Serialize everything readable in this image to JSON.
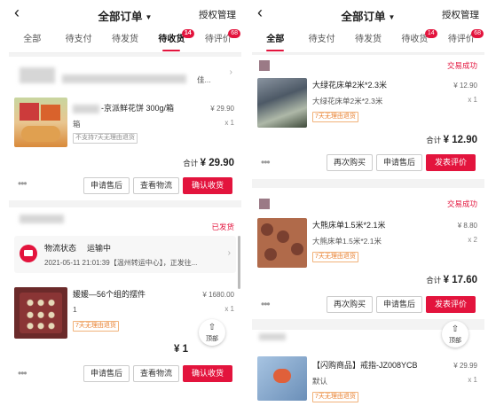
{
  "common": {
    "back_icon": "‹",
    "title": "全部订单",
    "caret": "▼",
    "auth": "授权管理",
    "more": "•••",
    "top_arrow": "⇧",
    "top_label": "顶部",
    "chevron": "›"
  },
  "left": {
    "tabs": [
      {
        "label": "全部",
        "badge": ""
      },
      {
        "label": "待支付",
        "badge": ""
      },
      {
        "label": "待发货",
        "badge": ""
      },
      {
        "label": "待收货",
        "badge": "14"
      },
      {
        "label": "待评价",
        "badge": "68"
      }
    ],
    "order1": {
      "shop_suffix": "佳...",
      "title": "-京派鲜花饼  300g/箱",
      "spec": "箱",
      "price": "¥ 29.90",
      "qty": "x 1",
      "tag": "不支持7天无理由退货",
      "total_label": "合计",
      "total_value": "¥ 29.90",
      "buttons": [
        "申请售后",
        "查看物流",
        "确认收货"
      ]
    },
    "order2": {
      "status": "已发货",
      "logistics_label": "物流状态",
      "logistics_state": "运输中",
      "logistics_detail": "2021-05-11 21:01:39【温州转运中心】，正发往...",
      "title": "媛媛—56个组的摆件",
      "price": "¥ 1680.00",
      "spec": "1",
      "qty": "x 1",
      "tag": "7天无理由退货",
      "total_partial": "¥ 1",
      "buttons": [
        "申请售后",
        "查看物流",
        "确认收货"
      ]
    }
  },
  "right": {
    "tabs": [
      {
        "label": "全部",
        "badge": ""
      },
      {
        "label": "待支付",
        "badge": ""
      },
      {
        "label": "待发货",
        "badge": ""
      },
      {
        "label": "待收货",
        "badge": "14"
      },
      {
        "label": "待评价",
        "badge": "68"
      }
    ],
    "order1": {
      "status": "交易成功",
      "title": "大绿花床单2米*2.3米",
      "spec": "大绿花床单2米*2.3米",
      "price": "¥ 12.90",
      "qty": "x 1",
      "tag": "7天无理由退货",
      "total_label": "合计",
      "total_value": "¥ 12.90",
      "buttons": [
        "再次购买",
        "申请售后",
        "发表评价"
      ]
    },
    "order2": {
      "status": "交易成功",
      "title": "大熊床单1.5米*2.1米",
      "spec": "大熊床单1.5米*2.1米",
      "price": "¥ 8.80",
      "qty": "x 2",
      "tag": "7天无理由退货",
      "total_label": "合计",
      "total_value": "¥ 17.60",
      "buttons": [
        "再次购买",
        "申请售后",
        "发表评价"
      ]
    },
    "order3": {
      "title": "【闪购商品】戒指-JZ008YCB",
      "spec": "默认",
      "price": "¥ 29.99",
      "qty": "x 1",
      "tag": "7天无理由退货"
    }
  }
}
